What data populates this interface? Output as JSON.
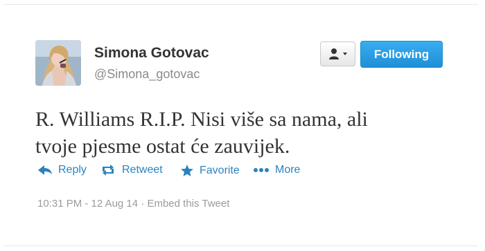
{
  "profile": {
    "name": "Simona Gotovac",
    "handle": "@Simona_gotovac"
  },
  "header": {
    "follow_label": "Following",
    "accent_color": "#2a9ce6"
  },
  "tweet": {
    "lines": [
      "R. Williams R.I.P. Nisi više sa nama, ali",
      "tvoje pjesme ostat će zauvijek."
    ]
  },
  "actions": [
    {
      "label": "Reply",
      "icon": "reply-icon"
    },
    {
      "label": "Retweet",
      "icon": "retweet-icon"
    },
    {
      "label": "Favorite",
      "icon": "star-icon"
    },
    {
      "label": "More",
      "icon": "more-icon"
    }
  ],
  "meta": {
    "timestamp": "10:31 PM - 12 Aug 14",
    "separator": "·",
    "embed_label": "Embed this Tweet"
  }
}
